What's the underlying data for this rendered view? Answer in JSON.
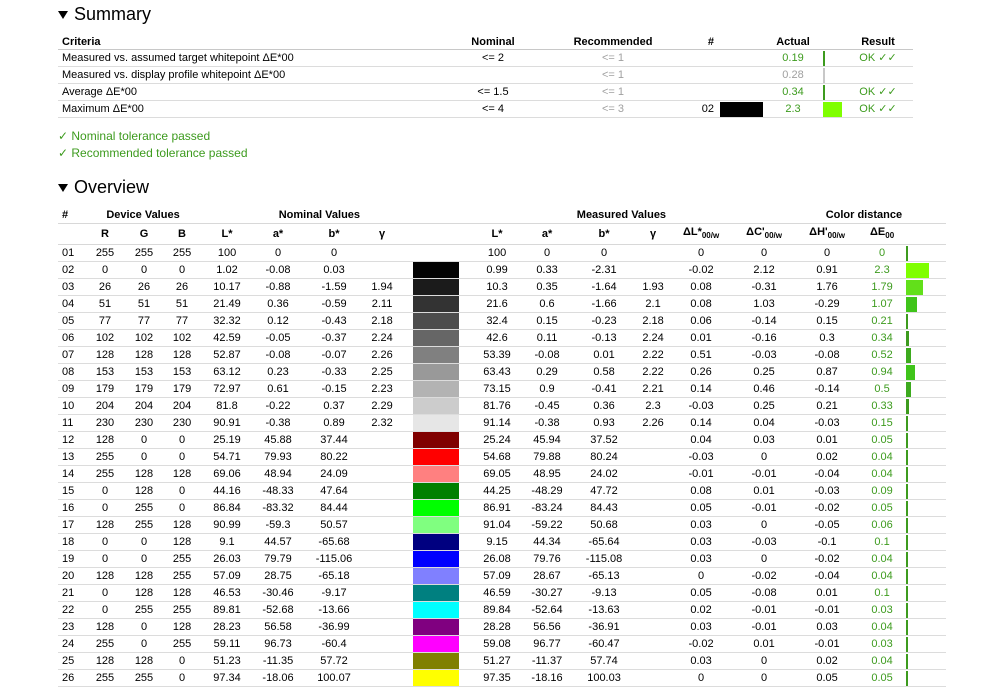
{
  "summary": {
    "title": "Summary",
    "headers": {
      "criteria": "Criteria",
      "nominal": "Nominal",
      "recommended": "Recommended",
      "num": "#",
      "actual": "Actual",
      "result": "Result"
    },
    "rows": [
      {
        "criteria": "Measured vs. assumed target whitepoint ΔE*00",
        "nominal": "<= 2",
        "recommended": "<= 1",
        "num": "",
        "swatch": "",
        "actual": "0.19",
        "bar_color": "#3d9b1e",
        "bar_fraction": 0.03,
        "result": "OK ✓✓",
        "gray_actual": false
      },
      {
        "criteria": "Measured vs. display profile whitepoint ΔE*00",
        "nominal": "",
        "recommended": "<= 1",
        "num": "",
        "swatch": "",
        "actual": "0.28",
        "bar_color": "#c8c8c8",
        "bar_fraction": 0.04,
        "result": "",
        "gray_actual": true
      },
      {
        "criteria": "Average ΔE*00",
        "nominal": "<= 1.5",
        "recommended": "<= 1",
        "num": "",
        "swatch": "",
        "actual": "0.34",
        "bar_color": "#3d9b1e",
        "bar_fraction": 0.05,
        "result": "OK ✓✓",
        "gray_actual": false
      },
      {
        "criteria": "Maximum ΔE*00",
        "nominal": "<= 4",
        "recommended": "<= 3",
        "num": "02",
        "swatch": "#000000",
        "actual": "2.3",
        "bar_color": "#7fff00",
        "bar_fraction": 0.95,
        "result": "OK ✓✓",
        "gray_actual": false
      }
    ],
    "pass_nominal": "✓ Nominal tolerance passed",
    "pass_recommended": "✓ Recommended tolerance passed"
  },
  "overview": {
    "title": "Overview",
    "group_headers": {
      "num": "#",
      "device": "Device Values",
      "nominal": "Nominal Values",
      "measured": "Measured Values",
      "distance": "Color distance"
    },
    "sub_headers": {
      "r": "R",
      "g": "G",
      "b": "B",
      "L": "L*",
      "a": "a*",
      "bb": "b*",
      "gamma": "γ",
      "mL": "L*",
      "ma": "a*",
      "mb": "b*",
      "mgamma": "γ",
      "dL": "ΔL*",
      "dC": "ΔC'",
      "dH": "ΔH'",
      "dE": "ΔE",
      "sub00w": "00/w",
      "sub00": "00"
    },
    "rows": [
      {
        "n": "01",
        "r": "255",
        "g": "255",
        "b": "255",
        "L": "100",
        "a": "0",
        "bb": "0",
        "gamma": "",
        "patch": "#ffffff",
        "mL": "100",
        "ma": "0",
        "mb": "0",
        "mgamma": "",
        "dL": "0",
        "dC": "0",
        "dH": "0",
        "dE": "0",
        "de_frac": 0.0,
        "bar": "#3d9b1e"
      },
      {
        "n": "02",
        "r": "0",
        "g": "0",
        "b": "0",
        "L": "1.02",
        "a": "-0.08",
        "bb": "0.03",
        "gamma": "",
        "patch": "#030303",
        "mL": "0.99",
        "ma": "0.33",
        "mb": "-2.31",
        "mgamma": "",
        "dL": "-0.02",
        "dC": "2.12",
        "dH": "0.91",
        "dE": "2.3",
        "de_frac": 0.95,
        "bar": "#7fff00"
      },
      {
        "n": "03",
        "r": "26",
        "g": "26",
        "b": "26",
        "L": "10.17",
        "a": "-0.88",
        "bb": "-1.59",
        "gamma": "1.94",
        "patch": "#1b1b1b",
        "mL": "10.3",
        "ma": "0.35",
        "mb": "-1.64",
        "mgamma": "1.93",
        "dL": "0.08",
        "dC": "-0.31",
        "dH": "1.76",
        "dE": "1.79",
        "de_frac": 0.7,
        "bar": "#62e01a"
      },
      {
        "n": "04",
        "r": "51",
        "g": "51",
        "b": "51",
        "L": "21.49",
        "a": "0.36",
        "bb": "-0.59",
        "gamma": "2.11",
        "patch": "#333333",
        "mL": "21.6",
        "ma": "0.6",
        "mb": "-1.66",
        "mgamma": "2.1",
        "dL": "0.08",
        "dC": "1.03",
        "dH": "-0.29",
        "dE": "1.07",
        "de_frac": 0.45,
        "bar": "#3fc41a"
      },
      {
        "n": "05",
        "r": "77",
        "g": "77",
        "b": "77",
        "L": "32.32",
        "a": "0.12",
        "bb": "-0.43",
        "gamma": "2.18",
        "patch": "#4d4d4d",
        "mL": "32.4",
        "ma": "0.15",
        "mb": "-0.23",
        "mgamma": "2.18",
        "dL": "0.06",
        "dC": "-0.14",
        "dH": "0.15",
        "dE": "0.21",
        "de_frac": 0.09,
        "bar": "#3d9b1e"
      },
      {
        "n": "06",
        "r": "102",
        "g": "102",
        "b": "102",
        "L": "42.59",
        "a": "-0.05",
        "bb": "-0.37",
        "gamma": "2.24",
        "patch": "#666666",
        "mL": "42.6",
        "ma": "0.11",
        "mb": "-0.13",
        "mgamma": "2.24",
        "dL": "0.01",
        "dC": "-0.16",
        "dH": "0.3",
        "dE": "0.34",
        "de_frac": 0.14,
        "bar": "#3d9b1e"
      },
      {
        "n": "07",
        "r": "128",
        "g": "128",
        "b": "128",
        "L": "52.87",
        "a": "-0.08",
        "bb": "-0.07",
        "gamma": "2.26",
        "patch": "#808080",
        "mL": "53.39",
        "ma": "-0.08",
        "mb": "0.01",
        "mgamma": "2.22",
        "dL": "0.51",
        "dC": "-0.03",
        "dH": "-0.08",
        "dE": "0.52",
        "de_frac": 0.22,
        "bar": "#3daa1e"
      },
      {
        "n": "08",
        "r": "153",
        "g": "153",
        "b": "153",
        "L": "63.12",
        "a": "0.23",
        "bb": "-0.33",
        "gamma": "2.25",
        "patch": "#999999",
        "mL": "63.43",
        "ma": "0.29",
        "mb": "0.58",
        "mgamma": "2.22",
        "dL": "0.26",
        "dC": "0.25",
        "dH": "0.87",
        "dE": "0.94",
        "de_frac": 0.38,
        "bar": "#3fc41a"
      },
      {
        "n": "09",
        "r": "179",
        "g": "179",
        "b": "179",
        "L": "72.97",
        "a": "0.61",
        "bb": "-0.15",
        "gamma": "2.23",
        "patch": "#b3b3b3",
        "mL": "73.15",
        "ma": "0.9",
        "mb": "-0.41",
        "mgamma": "2.21",
        "dL": "0.14",
        "dC": "0.46",
        "dH": "-0.14",
        "dE": "0.5",
        "de_frac": 0.2,
        "bar": "#3daa1e"
      },
      {
        "n": "10",
        "r": "204",
        "g": "204",
        "b": "204",
        "L": "81.8",
        "a": "-0.22",
        "bb": "0.37",
        "gamma": "2.29",
        "patch": "#cccccc",
        "mL": "81.76",
        "ma": "-0.45",
        "mb": "0.36",
        "mgamma": "2.3",
        "dL": "-0.03",
        "dC": "0.25",
        "dH": "0.21",
        "dE": "0.33",
        "de_frac": 0.14,
        "bar": "#3d9b1e"
      },
      {
        "n": "11",
        "r": "230",
        "g": "230",
        "b": "230",
        "L": "90.91",
        "a": "-0.38",
        "bb": "0.89",
        "gamma": "2.32",
        "patch": "#e6e6e6",
        "mL": "91.14",
        "ma": "-0.38",
        "mb": "0.93",
        "mgamma": "2.26",
        "dL": "0.14",
        "dC": "0.04",
        "dH": "-0.03",
        "dE": "0.15",
        "de_frac": 0.07,
        "bar": "#3d9b1e"
      },
      {
        "n": "12",
        "r": "128",
        "g": "0",
        "b": "0",
        "L": "25.19",
        "a": "45.88",
        "bb": "37.44",
        "gamma": "",
        "patch": "#800000",
        "mL": "25.24",
        "ma": "45.94",
        "mb": "37.52",
        "mgamma": "",
        "dL": "0.04",
        "dC": "0.03",
        "dH": "0.01",
        "dE": "0.05",
        "de_frac": 0.03,
        "bar": "#3d9b1e"
      },
      {
        "n": "13",
        "r": "255",
        "g": "0",
        "b": "0",
        "L": "54.71",
        "a": "79.93",
        "bb": "80.22",
        "gamma": "",
        "patch": "#ff0000",
        "mL": "54.68",
        "ma": "79.88",
        "mb": "80.24",
        "mgamma": "",
        "dL": "-0.03",
        "dC": "0",
        "dH": "0.02",
        "dE": "0.04",
        "de_frac": 0.02,
        "bar": "#3d9b1e"
      },
      {
        "n": "14",
        "r": "255",
        "g": "128",
        "b": "128",
        "L": "69.06",
        "a": "48.94",
        "bb": "24.09",
        "gamma": "",
        "patch": "#ff8080",
        "mL": "69.05",
        "ma": "48.95",
        "mb": "24.02",
        "mgamma": "",
        "dL": "-0.01",
        "dC": "-0.01",
        "dH": "-0.04",
        "dE": "0.04",
        "de_frac": 0.02,
        "bar": "#3d9b1e"
      },
      {
        "n": "15",
        "r": "0",
        "g": "128",
        "b": "0",
        "L": "44.16",
        "a": "-48.33",
        "bb": "47.64",
        "gamma": "",
        "patch": "#008000",
        "mL": "44.25",
        "ma": "-48.29",
        "mb": "47.72",
        "mgamma": "",
        "dL": "0.08",
        "dC": "0.01",
        "dH": "-0.03",
        "dE": "0.09",
        "de_frac": 0.04,
        "bar": "#3d9b1e"
      },
      {
        "n": "16",
        "r": "0",
        "g": "255",
        "b": "0",
        "L": "86.84",
        "a": "-83.32",
        "bb": "84.44",
        "gamma": "",
        "patch": "#00ff00",
        "mL": "86.91",
        "ma": "-83.24",
        "mb": "84.43",
        "mgamma": "",
        "dL": "0.05",
        "dC": "-0.01",
        "dH": "-0.02",
        "dE": "0.05",
        "de_frac": 0.03,
        "bar": "#3d9b1e"
      },
      {
        "n": "17",
        "r": "128",
        "g": "255",
        "b": "128",
        "L": "90.99",
        "a": "-59.3",
        "bb": "50.57",
        "gamma": "",
        "patch": "#80ff80",
        "mL": "91.04",
        "ma": "-59.22",
        "mb": "50.68",
        "mgamma": "",
        "dL": "0.03",
        "dC": "0",
        "dH": "-0.05",
        "dE": "0.06",
        "de_frac": 0.03,
        "bar": "#3d9b1e"
      },
      {
        "n": "18",
        "r": "0",
        "g": "0",
        "b": "128",
        "L": "9.1",
        "a": "44.57",
        "bb": "-65.68",
        "gamma": "",
        "patch": "#000080",
        "mL": "9.15",
        "ma": "44.34",
        "mb": "-65.64",
        "mgamma": "",
        "dL": "0.03",
        "dC": "-0.03",
        "dH": "-0.1",
        "dE": "0.1",
        "de_frac": 0.05,
        "bar": "#3d9b1e"
      },
      {
        "n": "19",
        "r": "0",
        "g": "0",
        "b": "255",
        "L": "26.03",
        "a": "79.79",
        "bb": "-115.06",
        "gamma": "",
        "patch": "#0000ff",
        "mL": "26.08",
        "ma": "79.76",
        "mb": "-115.08",
        "mgamma": "",
        "dL": "0.03",
        "dC": "0",
        "dH": "-0.02",
        "dE": "0.04",
        "de_frac": 0.02,
        "bar": "#3d9b1e"
      },
      {
        "n": "20",
        "r": "128",
        "g": "128",
        "b": "255",
        "L": "57.09",
        "a": "28.75",
        "bb": "-65.18",
        "gamma": "",
        "patch": "#8080ff",
        "mL": "57.09",
        "ma": "28.67",
        "mb": "-65.13",
        "mgamma": "",
        "dL": "0",
        "dC": "-0.02",
        "dH": "-0.04",
        "dE": "0.04",
        "de_frac": 0.02,
        "bar": "#3d9b1e"
      },
      {
        "n": "21",
        "r": "0",
        "g": "128",
        "b": "128",
        "L": "46.53",
        "a": "-30.46",
        "bb": "-9.17",
        "gamma": "",
        "patch": "#008080",
        "mL": "46.59",
        "ma": "-30.27",
        "mb": "-9.13",
        "mgamma": "",
        "dL": "0.05",
        "dC": "-0.08",
        "dH": "0.01",
        "dE": "0.1",
        "de_frac": 0.05,
        "bar": "#3d9b1e"
      },
      {
        "n": "22",
        "r": "0",
        "g": "255",
        "b": "255",
        "L": "89.81",
        "a": "-52.68",
        "bb": "-13.66",
        "gamma": "",
        "patch": "#00ffff",
        "mL": "89.84",
        "ma": "-52.64",
        "mb": "-13.63",
        "mgamma": "",
        "dL": "0.02",
        "dC": "-0.01",
        "dH": "-0.01",
        "dE": "0.03",
        "de_frac": 0.02,
        "bar": "#3d9b1e"
      },
      {
        "n": "23",
        "r": "128",
        "g": "0",
        "b": "128",
        "L": "28.23",
        "a": "56.58",
        "bb": "-36.99",
        "gamma": "",
        "patch": "#800080",
        "mL": "28.28",
        "ma": "56.56",
        "mb": "-36.91",
        "mgamma": "",
        "dL": "0.03",
        "dC": "-0.01",
        "dH": "0.03",
        "dE": "0.04",
        "de_frac": 0.02,
        "bar": "#3d9b1e"
      },
      {
        "n": "24",
        "r": "255",
        "g": "0",
        "b": "255",
        "L": "59.11",
        "a": "96.73",
        "bb": "-60.4",
        "gamma": "",
        "patch": "#ff00ff",
        "mL": "59.08",
        "ma": "96.77",
        "mb": "-60.47",
        "mgamma": "",
        "dL": "-0.02",
        "dC": "0.01",
        "dH": "-0.01",
        "dE": "0.03",
        "de_frac": 0.02,
        "bar": "#3d9b1e"
      },
      {
        "n": "25",
        "r": "128",
        "g": "128",
        "b": "0",
        "L": "51.23",
        "a": "-11.35",
        "bb": "57.72",
        "gamma": "",
        "patch": "#808000",
        "mL": "51.27",
        "ma": "-11.37",
        "mb": "57.74",
        "mgamma": "",
        "dL": "0.03",
        "dC": "0",
        "dH": "0.02",
        "dE": "0.04",
        "de_frac": 0.02,
        "bar": "#3d9b1e"
      },
      {
        "n": "26",
        "r": "255",
        "g": "255",
        "b": "0",
        "L": "97.34",
        "a": "-18.06",
        "bb": "100.07",
        "gamma": "",
        "patch": "#ffff00",
        "mL": "97.35",
        "ma": "-18.16",
        "mb": "100.03",
        "mgamma": "",
        "dL": "0",
        "dC": "0",
        "dH": "0.05",
        "dE": "0.05",
        "de_frac": 0.03,
        "bar": "#3d9b1e"
      }
    ]
  }
}
